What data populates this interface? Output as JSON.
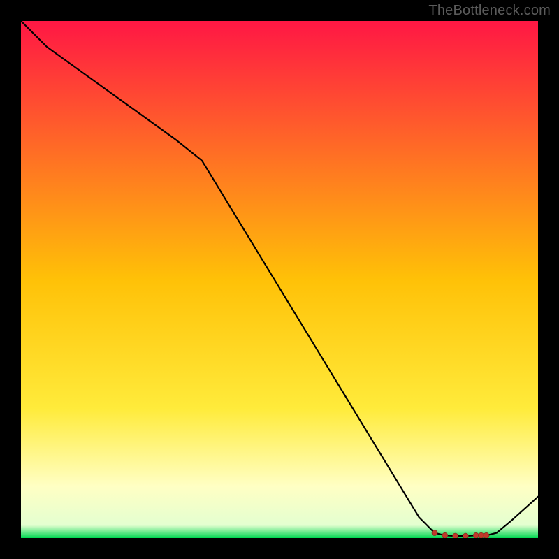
{
  "watermark": "TheBottleneck.com",
  "chart_data": {
    "type": "line",
    "title": "",
    "xlabel": "",
    "ylabel": "",
    "xlim": [
      0,
      100
    ],
    "ylim": [
      0,
      100
    ],
    "grid": false,
    "legend": false,
    "series": [
      {
        "name": "curve",
        "x": [
          0,
          5,
          30,
          35,
          77,
          80,
          82,
          84,
          86,
          88,
          89,
          90,
          92,
          95,
          100
        ],
        "values": [
          100,
          95,
          77,
          73,
          4,
          1,
          0.5,
          0.4,
          0.4,
          0.5,
          0.5,
          0.5,
          1,
          3.5,
          8
        ]
      }
    ],
    "markers": {
      "x": [
        80,
        82,
        84,
        86,
        88,
        89,
        90
      ],
      "values": [
        1,
        0.5,
        0.4,
        0.4,
        0.5,
        0.5,
        0.5
      ]
    },
    "background_gradient": {
      "top_color": "#ff1744",
      "mid_color": "#ffeb3b",
      "near_bottom_color": "#ffffc4",
      "bottom_color": "#00d651"
    }
  }
}
